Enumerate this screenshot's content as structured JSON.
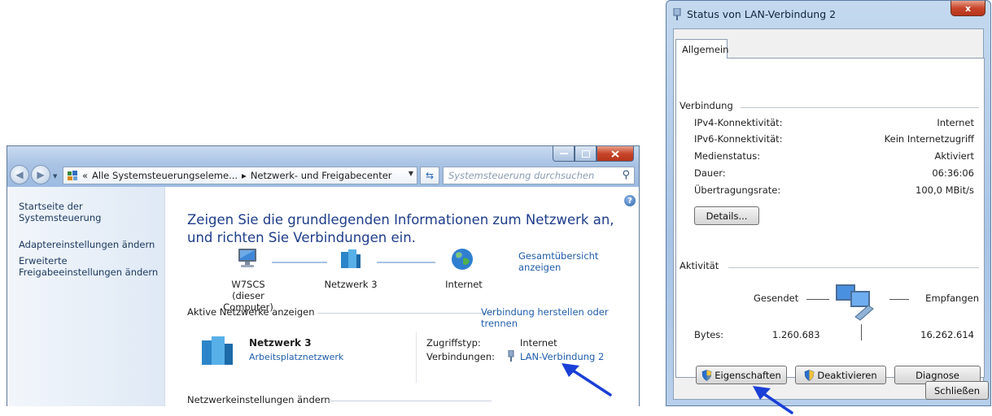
{
  "explorer": {
    "breadcrumb": {
      "prefix": "«",
      "segment1": "Alle Systemsteuerungseleme...",
      "separator": "▸",
      "segment2": "Netzwerk- und Freigabecenter"
    },
    "search_placeholder": "Systemsteuerung durchsuchen",
    "sidebar": {
      "items": [
        {
          "label": "Startseite der Systemsteuerung"
        },
        {
          "label": "Adaptereinstellungen ändern"
        },
        {
          "label": "Erweiterte"
        },
        {
          "label": "Freigabeeinstellungen ändern"
        }
      ]
    },
    "heading": "Zeigen Sie die grundlegenden Informationen zum Netzwerk an, und richten Sie Verbindungen ein.",
    "full_map_link": "Gesamtübersicht anzeigen",
    "map": {
      "computer_name": "W7SCS",
      "computer_sub": "(dieser Computer)",
      "network_name": "Netzwerk 3",
      "internet_label": "Internet"
    },
    "active_networks_header": "Aktive Netzwerke anzeigen",
    "connect_link": "Verbindung herstellen oder trennen",
    "active": {
      "name": "Netzwerk 3",
      "type_link": "Arbeitsplatznetzwerk",
      "access_label": "Zugriffstyp:",
      "access_value": "Internet",
      "connections_label": "Verbindungen:",
      "connections_link": "LAN-Verbindung 2"
    },
    "change_settings_header": "Netzwerkeinstellungen ändern",
    "colors": {
      "link": "#1f5dab",
      "heading": "#1e3d8a",
      "annotation_arrow": "#1a3fd6"
    }
  },
  "dialog": {
    "title": "Status von LAN-Verbindung 2",
    "close_glyph": "x",
    "tab": "Allgemein",
    "connection_group": "Verbindung",
    "rows": [
      {
        "label": "IPv4-Konnektivität:",
        "value": "Internet"
      },
      {
        "label": "IPv6-Konnektivität:",
        "value": "Kein Internetzugriff"
      },
      {
        "label": "Medienstatus:",
        "value": "Aktiviert"
      },
      {
        "label": "Dauer:",
        "value": "06:36:06"
      },
      {
        "label": "Übertragungsrate:",
        "value": "100,0 MBit/s"
      }
    ],
    "details_button": "Details...",
    "activity_group": "Aktivität",
    "sent_label": "Gesendet",
    "received_label": "Empfangen",
    "bytes_label": "Bytes:",
    "bytes_sent": "1.260.683",
    "bytes_received": "16.262.614",
    "properties_button": "Eigenschaften",
    "disable_button": "Deaktivieren",
    "diagnose_button": "Diagnose",
    "close_button": "Schließen"
  }
}
